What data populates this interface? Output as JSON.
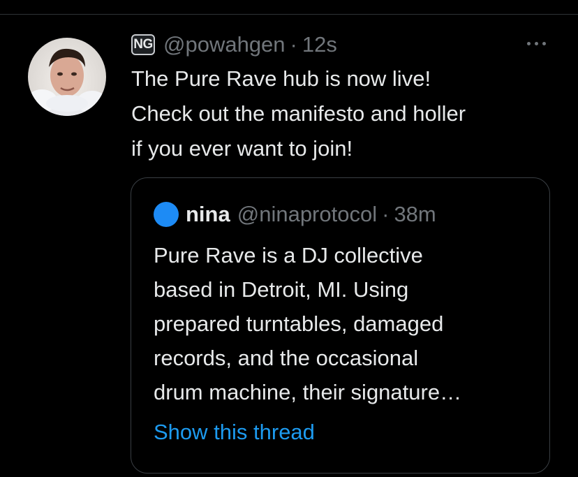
{
  "tweet": {
    "badge_text": "NG",
    "handle": "@powahgen",
    "separator": "·",
    "time": "12s",
    "text": "The Pure Rave hub is now live!\nCheck out the manifesto and holler\nif you ever want to join!",
    "more_icon": "more-horizontal-icon"
  },
  "quote": {
    "name": "nina",
    "handle": "@ninaprotocol",
    "separator": "·",
    "time": "38m",
    "avatar_color": "#1d8bf5",
    "text": "Pure Rave is a DJ collective\nbased in Detroit, MI. Using\nprepared turntables, damaged\nrecords, and the occasional\ndrum machine, their signature…",
    "show_thread_label": "Show this thread"
  },
  "colors": {
    "background": "#000000",
    "text": "#e7e9ea",
    "muted": "#71767b",
    "link": "#1d9bf0",
    "border": "#3a3f44"
  }
}
